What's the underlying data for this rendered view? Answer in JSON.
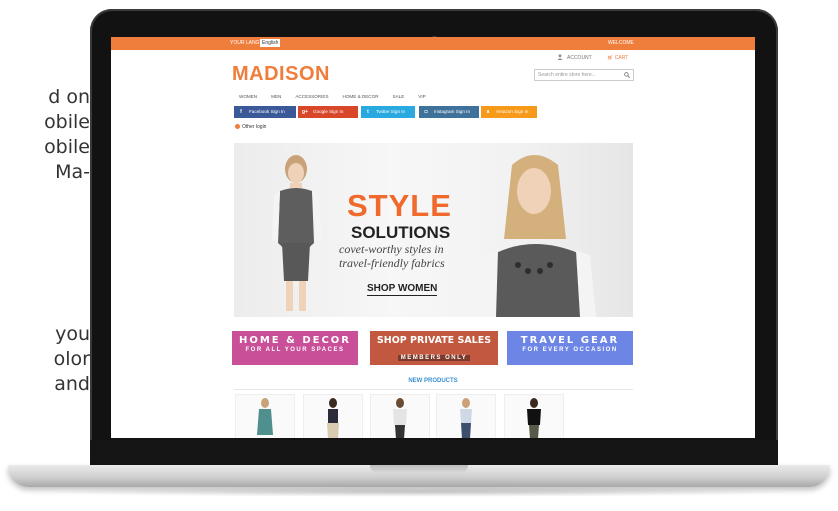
{
  "side_text": [
    "d on",
    "obile",
    "obile",
    "Ma-",
    "you",
    "olor",
    "and"
  ],
  "store": {
    "topbar": {
      "language_label": "YOUR LANGUAGE:",
      "language_value": "English",
      "welcome": "WELCOME"
    },
    "header": {
      "logo": "MADISON",
      "account": "ACCOUNT",
      "cart": "CART",
      "search_placeholder": "Search entire store here..."
    },
    "nav": [
      "WOMEN",
      "MEN",
      "ACCESSORIES",
      "HOME & DECOR",
      "SALE",
      "VIP"
    ],
    "social_buttons": [
      {
        "label": "Facebook Sign In",
        "icon": "f",
        "color": "#3b5998"
      },
      {
        "label": "Google Sign In",
        "icon": "g+",
        "color": "#d9472b"
      },
      {
        "label": "Twitter Sign In",
        "icon": "t",
        "color": "#28a9e0"
      },
      {
        "label": "Instagram Sign In",
        "icon": "◘",
        "color": "#3f729b"
      },
      {
        "label": "Amazon Sign In",
        "icon": "a",
        "color": "#f79a19"
      }
    ],
    "other_logins": "Other login",
    "banner": {
      "headline": "STYLE",
      "subheadline": "SOLUTIONS",
      "tagline1": "covet-worthy styles in",
      "tagline2": "travel-friendly fabrics",
      "cta": "SHOP WOMEN"
    },
    "promos": [
      {
        "title": "HOME & DECOR",
        "subtitle": "FOR ALL YOUR SPACES",
        "color": "#c94f98"
      },
      {
        "title": "SHOP PRIVATE SALES",
        "subtitle": "MEMBERS ONLY",
        "color": "#c2583f"
      },
      {
        "title": "TRAVEL GEAR",
        "subtitle": "FOR EVERY OCCASION",
        "color": "#6d86e6"
      }
    ],
    "new_products": "NEW PRODUCTS"
  },
  "colors": {
    "accent": "#ef7d3c",
    "link": "#3b8fd0"
  }
}
